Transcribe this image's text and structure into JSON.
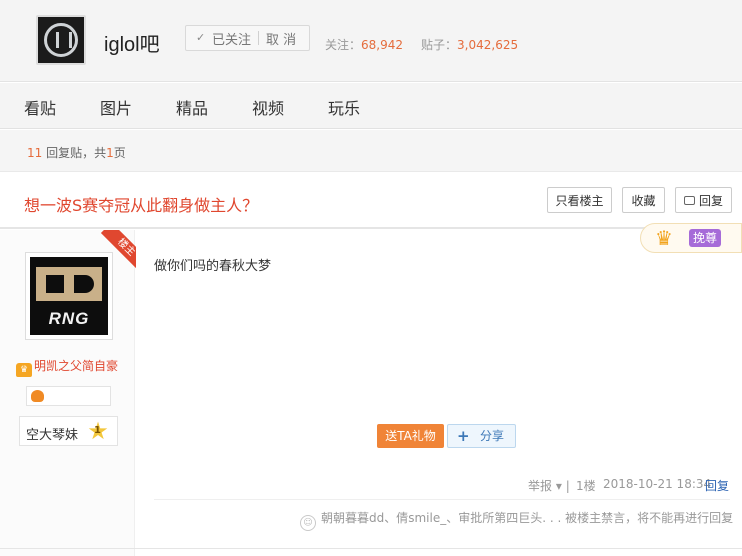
{
  "header": {
    "forum_name": "iglol吧",
    "follow": {
      "check_icon": "✓",
      "followed_label": "已关注",
      "cancel_label": "取 消"
    },
    "stats": {
      "followers_label": "关注：",
      "followers_value": "68,942",
      "posts_label": "贴子：",
      "posts_value": "3,042,625"
    }
  },
  "nav": {
    "tabs": [
      "看贴",
      "图片",
      "精品",
      "视频",
      "玩乐"
    ]
  },
  "reply_bar": {
    "count": "11",
    "text_mid": "回复贴，共",
    "pages": "1",
    "text_end": "页"
  },
  "thread": {
    "title": "想一波S赛夺冠从此翻身做主人？",
    "buttons": {
      "only_op": "只看楼主",
      "favorite": "收藏",
      "reply": "回复"
    }
  },
  "post": {
    "op_badge": "楼主",
    "avatar_text": "RNG",
    "author": "明凯之父简自豪",
    "level_name": "空大琴妹",
    "level_num": "1",
    "content": "做你们吗的春秋大梦",
    "crown_badge_label": "挽尊",
    "gift_label": "送TA礼物",
    "share_label": "分享",
    "report_label": "举报",
    "floor": "1楼",
    "datetime": "2018-10-21 18:34",
    "reply_label": "回复",
    "likers_text": "朝朝暮暮dd、倩smile_、审批所第四巨头. . . 被楼主禁言，将不能再进行回复"
  },
  "colors": {
    "accent_red": "#e0472f",
    "orange": "#f08437",
    "link_blue": "#2d64b3",
    "stat_orange": "#e56c3c"
  },
  "icons": [
    "forum-logo-icon",
    "check-icon",
    "crown-icon",
    "flame-badge-icon",
    "level-star-icon",
    "plus-icon",
    "dropdown-arrow-icon",
    "thumb-icon",
    "comment-icon"
  ]
}
